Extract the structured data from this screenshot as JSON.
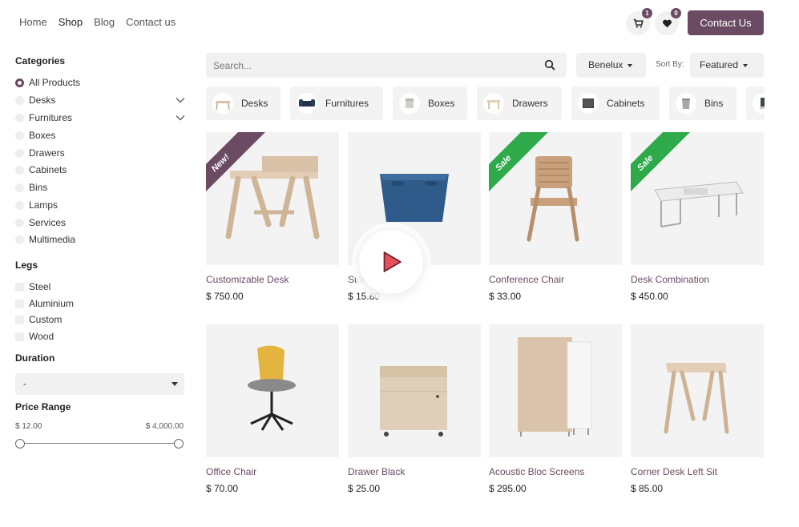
{
  "nav": {
    "items": [
      "Home",
      "Shop",
      "Blog",
      "Contact us"
    ]
  },
  "header": {
    "cart_count": "1",
    "wishlist_count": "0",
    "contact_label": "Contact Us"
  },
  "sidebar": {
    "categories_title": "Categories",
    "categories": [
      "All Products",
      "Desks",
      "Furnitures",
      "Boxes",
      "Drawers",
      "Cabinets",
      "Bins",
      "Lamps",
      "Services",
      "Multimedia"
    ],
    "legs_title": "Legs",
    "legs": [
      "Steel",
      "Aluminium",
      "Custom",
      "Wood"
    ],
    "duration_title": "Duration",
    "duration_value": "-",
    "price_title": "Price Range",
    "price_min": "$ 12.00",
    "price_max": "$ 4,000.00"
  },
  "search": {
    "placeholder": "Search..."
  },
  "region": "Benelux",
  "sort": {
    "label": "Sort By:",
    "value": "Featured"
  },
  "chips": [
    "Desks",
    "Furnitures",
    "Boxes",
    "Drawers",
    "Cabinets",
    "Bins"
  ],
  "products": [
    {
      "name": "Customizable Desk",
      "price": "$ 750.00",
      "ribbon": "New!"
    },
    {
      "name": "Storage Box",
      "price": "$ 15.80",
      "ribbon": ""
    },
    {
      "name": "Conference Chair",
      "price": "$ 33.00",
      "ribbon": "Sale"
    },
    {
      "name": "Desk Combination",
      "price": "$ 450.00",
      "ribbon": "Sale"
    },
    {
      "name": "Office Chair",
      "price": "$ 70.00",
      "ribbon": ""
    },
    {
      "name": "Drawer Black",
      "price": "$ 25.00",
      "ribbon": ""
    },
    {
      "name": "Acoustic Bloc Screens",
      "price": "$ 295.00",
      "ribbon": ""
    },
    {
      "name": "Corner Desk Left Sit",
      "price": "$ 85.00",
      "ribbon": ""
    }
  ],
  "colors": {
    "brand": "#6b4a64",
    "ribbon_new": "#6b4a64",
    "ribbon_sale": "#2eaa4a",
    "play": "#e8505b"
  }
}
